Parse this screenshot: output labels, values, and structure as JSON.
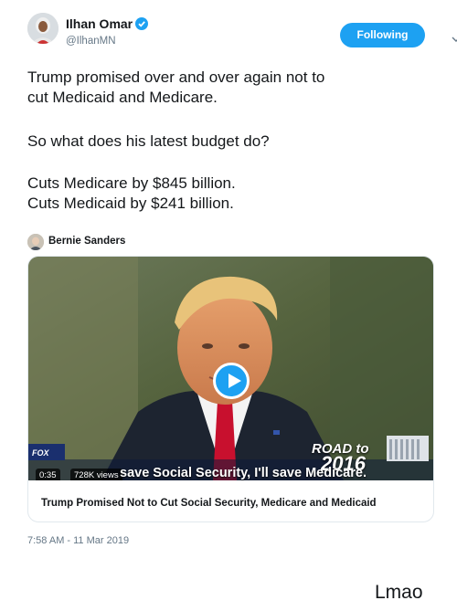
{
  "author": {
    "name": "Ilhan Omar",
    "handle": "@IlhanMN",
    "follow_label": "Following"
  },
  "tweet": {
    "lines_1": [
      "Trump promised over and over again not to",
      "cut Medicaid and Medicare."
    ],
    "lines_2": [
      "So what does his latest budget do?"
    ],
    "lines_3": [
      "Cuts Medicare by $845 billion.",
      "Cuts Medicaid by $241 billion."
    ]
  },
  "video_card": {
    "source_name": "Bernie Sanders",
    "duration": "0:35",
    "views": "728K views",
    "caption": "save Social Security, I'll save Medicare.",
    "road_text": "ROAD to",
    "road_year": "2016",
    "network_logo": "FOX",
    "title": "Trump Promised Not to Cut Social Security, Medicare and Medicaid"
  },
  "timestamp": "7:58 AM - 11 Mar 2019",
  "footer_caption": "Lmao",
  "colors": {
    "accent": "#1da1f2",
    "secondary_text": "#657786",
    "tie_red": "#c8102e"
  },
  "icons": {
    "verified": "verified-badge-icon",
    "chevron": "chevron-down-icon",
    "play": "play-icon"
  }
}
